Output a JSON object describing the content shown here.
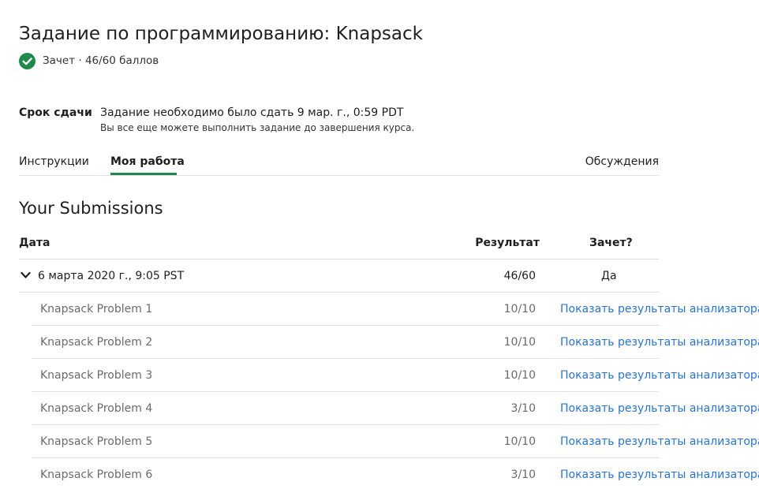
{
  "header": {
    "title": "Задание по программированию: Knapsack",
    "status_text": "Зачет · 46/60 баллов",
    "status_color": "#1f8a4c"
  },
  "deadline": {
    "label": "Срок сдачи",
    "main": "Задание необходимо было сдать 9 мар. г., 0:59 PDT",
    "sub": "Вы все еще можете выполнить задание до завершения курса."
  },
  "tabs": {
    "instructions": "Инструкции",
    "my_work": "Моя работа",
    "discussions": "Обсуждения"
  },
  "submissions": {
    "title": "Your Submissions",
    "columns": {
      "date": "Дата",
      "result": "Результат",
      "pass": "Зачет?"
    },
    "submission": {
      "date": "6 марта 2020 г., 9:05 PST",
      "score": "46/60",
      "pass": "Да"
    },
    "problems": [
      {
        "name": "Knapsack Problem 1",
        "score": "10/10",
        "link": "Показать результаты анализатора"
      },
      {
        "name": "Knapsack Problem 2",
        "score": "10/10",
        "link": "Показать результаты анализатора"
      },
      {
        "name": "Knapsack Problem 3",
        "score": "10/10",
        "link": "Показать результаты анализатора"
      },
      {
        "name": "Knapsack Problem 4",
        "score": "3/10",
        "link": "Показать результаты анализатора"
      },
      {
        "name": "Knapsack Problem 5",
        "score": "10/10",
        "link": "Показать результаты анализатора"
      },
      {
        "name": "Knapsack Problem 6",
        "score": "3/10",
        "link": "Показать результаты анализатора"
      }
    ]
  },
  "colors": {
    "accent": "#1f8a4c",
    "link": "#2a73cc"
  }
}
